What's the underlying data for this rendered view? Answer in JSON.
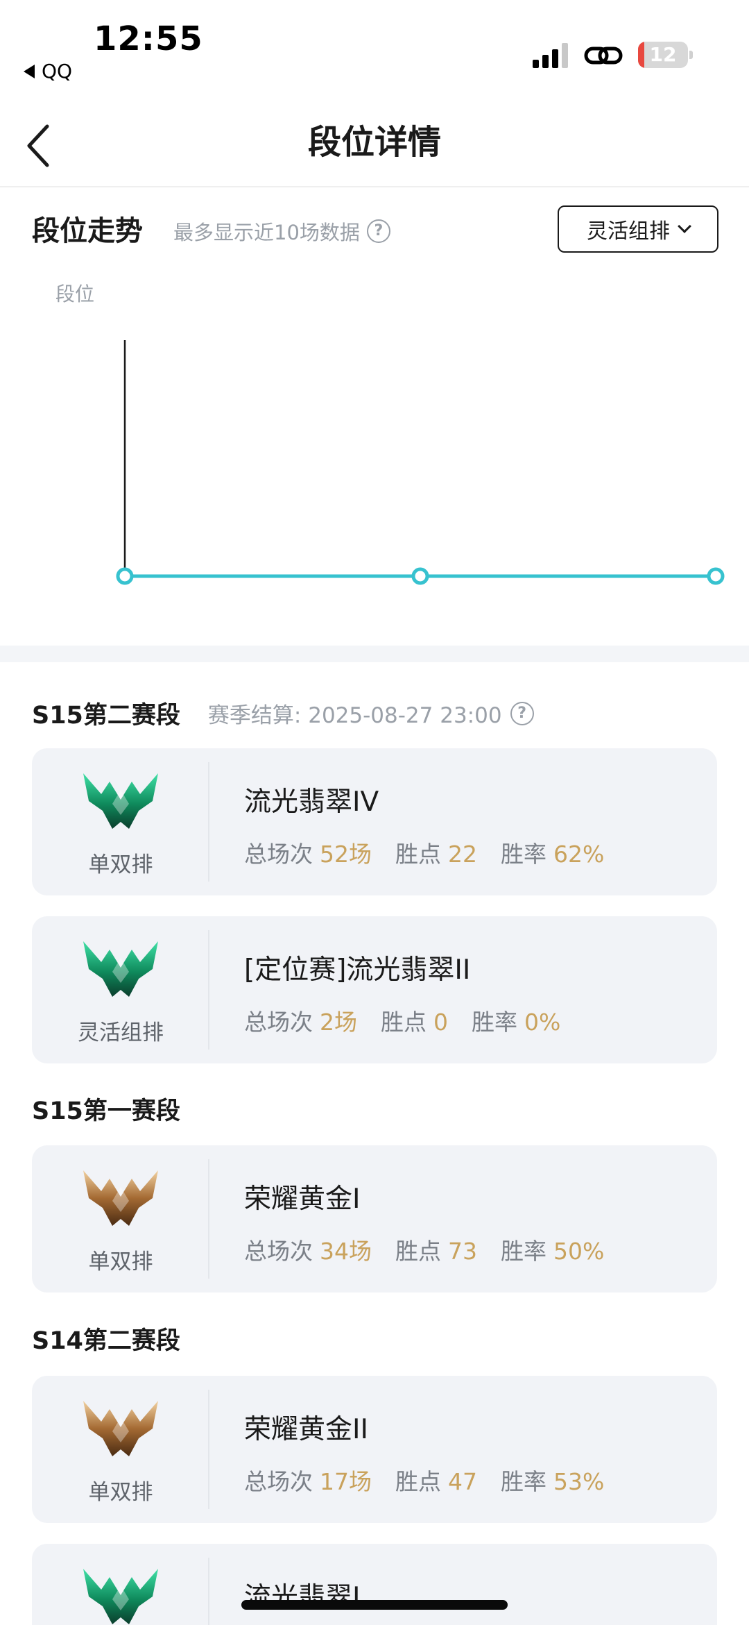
{
  "status_bar": {
    "time": "12:55",
    "back_app": "QQ",
    "battery_level": "12",
    "battery_fraction": 0.12
  },
  "nav": {
    "title": "段位详情"
  },
  "trend": {
    "title": "段位走势",
    "subtitle": "最多显示近10场数据",
    "help": "?",
    "mode_select": "灵活组排",
    "y_label": "段位",
    "line_color": "#37c2cf"
  },
  "chart_data": {
    "type": "line",
    "ylabel": "段位",
    "x": [
      1,
      2,
      3
    ],
    "series": [
      {
        "values": [
          0,
          0,
          0
        ]
      }
    ],
    "grid": false
  },
  "seasons": [
    {
      "title": "S15第二赛段",
      "settle": "赛季结算: 2025-08-27 23:00",
      "help": "?",
      "cards": [
        {
          "emblem": "emerald-emblem-icon",
          "queue": "单双排",
          "rank": "流光翡翠IV",
          "games_label": "总场次",
          "games": "52场",
          "lp_label": "胜点",
          "lp": "22",
          "wr_label": "胜率",
          "wr": "62%"
        },
        {
          "emblem": "emerald-emblem-icon",
          "queue": "灵活组排",
          "rank": "[定位赛]流光翡翠II",
          "games_label": "总场次",
          "games": "2场",
          "lp_label": "胜点",
          "lp": "0",
          "wr_label": "胜率",
          "wr": "0%"
        }
      ]
    },
    {
      "title": "S15第一赛段",
      "cards": [
        {
          "emblem": "gold-emblem-icon",
          "queue": "单双排",
          "rank": "荣耀黄金I",
          "games_label": "总场次",
          "games": "34场",
          "lp_label": "胜点",
          "lp": "73",
          "wr_label": "胜率",
          "wr": "50%"
        }
      ]
    },
    {
      "title": "S14第二赛段",
      "cards": [
        {
          "emblem": "gold-emblem-icon",
          "queue": "单双排",
          "rank": "荣耀黄金II",
          "games_label": "总场次",
          "games": "17场",
          "lp_label": "胜点",
          "lp": "47",
          "wr_label": "胜率",
          "wr": "53%"
        },
        {
          "emblem": "emerald-emblem-icon",
          "queue": "",
          "rank": "流光翡翠I"
        }
      ]
    }
  ]
}
